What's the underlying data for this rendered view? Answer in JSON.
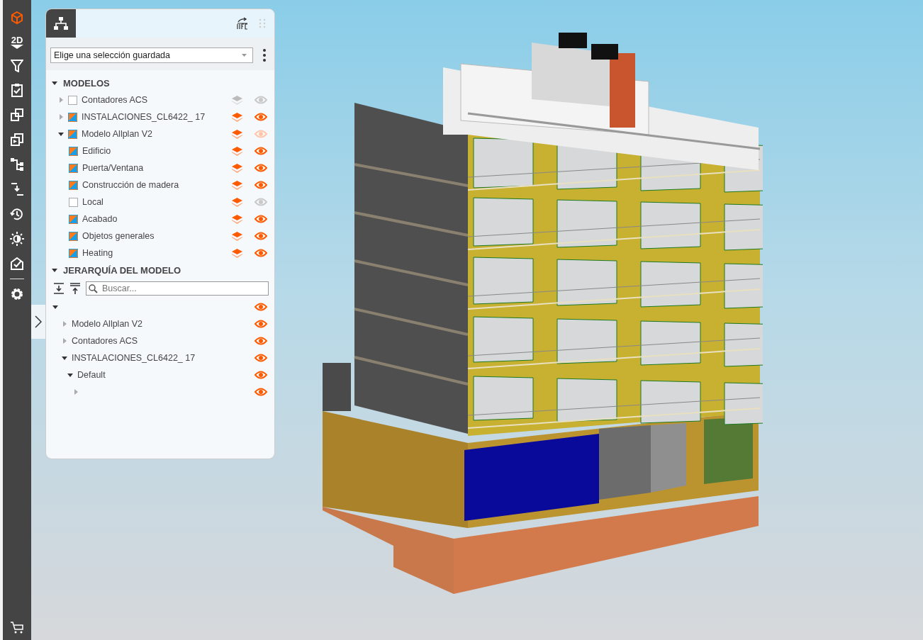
{
  "toolbar": {
    "view_toggle_label": "2D"
  },
  "panel": {
    "saved_selection": {
      "placeholder": "Elige una selección guardada"
    },
    "models": {
      "title": "MODELOS",
      "expanded": true,
      "items": [
        {
          "name": "Contadores ACS",
          "expanded": false,
          "colored": false,
          "layer_on": false,
          "visible": false,
          "partial": false
        },
        {
          "name": "INSTALACIONES_CL6422_ 17",
          "expanded": false,
          "colored": true,
          "layer_on": true,
          "visible": true,
          "partial": false
        },
        {
          "name": "Modelo Allplan V2",
          "expanded": true,
          "colored": true,
          "layer_on": true,
          "visible": true,
          "partial": true,
          "children": [
            {
              "name": "Edificio",
              "colored": true,
              "layer_on": true,
              "visible": true,
              "partial": false
            },
            {
              "name": "Puerta/Ventana",
              "colored": true,
              "layer_on": true,
              "visible": true,
              "partial": false
            },
            {
              "name": "Construcción de madera",
              "colored": true,
              "layer_on": true,
              "visible": true,
              "partial": false
            },
            {
              "name": "Local",
              "colored": false,
              "layer_on": true,
              "visible": false,
              "partial": false
            },
            {
              "name": "Acabado",
              "colored": true,
              "layer_on": true,
              "visible": true,
              "partial": false
            },
            {
              "name": "Objetos generales",
              "colored": true,
              "layer_on": true,
              "visible": true,
              "partial": false
            },
            {
              "name": "Heating",
              "colored": true,
              "layer_on": true,
              "visible": true,
              "partial": false
            }
          ]
        }
      ]
    },
    "hierarchy": {
      "title": "JERARQUÍA DEL MODELO",
      "expanded": true,
      "search": {
        "placeholder": "Buscar..."
      },
      "tree": [
        {
          "expanded": true,
          "visible": true,
          "children": [
            {
              "name": "Modelo Allplan V2",
              "expanded": false,
              "visible": true
            },
            {
              "name": "Contadores ACS",
              "expanded": false,
              "visible": true
            },
            {
              "name": "INSTALACIONES_CL6422_ 17",
              "expanded": true,
              "visible": true,
              "children": [
                {
                  "name": "Default",
                  "expanded": true,
                  "visible": true,
                  "children": [
                    {
                      "expanded": false,
                      "visible": true
                    }
                  ]
                }
              ]
            }
          ]
        }
      ]
    }
  }
}
